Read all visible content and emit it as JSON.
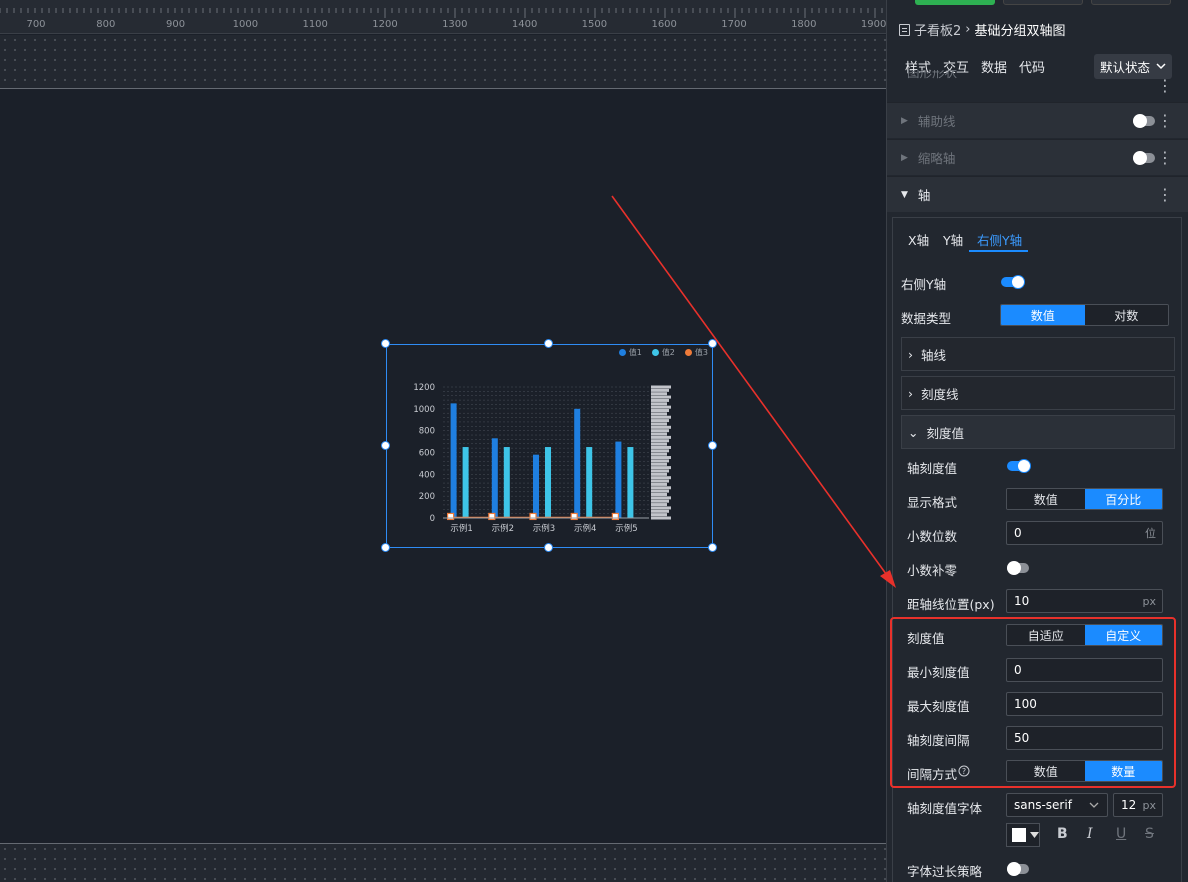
{
  "ruler": {
    "ticks": [
      "700",
      "800",
      "900",
      "1000",
      "1100",
      "1200",
      "1300",
      "1400",
      "1500",
      "1600",
      "1700",
      "1800",
      "1900"
    ]
  },
  "chart": {
    "legend": [
      {
        "label": "值1",
        "color": "#1f7fe0"
      },
      {
        "label": "值2",
        "color": "#3ec5e8"
      },
      {
        "label": "值3",
        "color": "#ef7b3a"
      }
    ]
  },
  "chart_data": {
    "type": "bar",
    "categories": [
      "示例1",
      "示例2",
      "示例3",
      "示例4",
      "示例5"
    ],
    "series": [
      {
        "name": "值1",
        "values": [
          1050,
          730,
          580,
          1000,
          700
        ],
        "color": "#1f7fe0"
      },
      {
        "name": "值2",
        "values": [
          650,
          650,
          650,
          650,
          650
        ],
        "color": "#3ec5e8"
      },
      {
        "name": "值3",
        "values": [
          5,
          5,
          5,
          5,
          5
        ],
        "color": "#ef7b3a",
        "type": "line"
      }
    ],
    "yticks": [
      "0",
      "200",
      "400",
      "600",
      "800",
      "1000",
      "1200"
    ],
    "ylim": [
      0,
      1200
    ],
    "right_axis_ticks": "dense overlapping percentage labels",
    "grid": true,
    "legend_position": "top-right"
  },
  "panel": {
    "breadcrumb": {
      "parent": "子看板2",
      "sep": "›",
      "current": "基础分组双轴图"
    },
    "tabs": [
      "样式",
      "交互",
      "数据",
      "代码"
    ],
    "state_select": "默认状态",
    "sections": [
      {
        "label": "图形形状"
      },
      {
        "label": "辅助线"
      },
      {
        "label": "缩略轴"
      },
      {
        "label": "轴"
      }
    ],
    "axis_tabs": [
      "X轴",
      "Y轴",
      "右侧Y轴"
    ],
    "right_y": {
      "enabled_label": "右侧Y轴",
      "data_type_label": "数据类型",
      "data_type_options": [
        "数值",
        "对数"
      ],
      "folds": [
        "轴线",
        "刻度线",
        "刻度值"
      ],
      "tick_value_label": "轴刻度值",
      "display_format_label": "显示格式",
      "display_format_options": [
        "数值",
        "百分比"
      ],
      "decimals_label": "小数位数",
      "decimals_value": "0",
      "decimals_unit": "位",
      "pad_zero_label": "小数补零",
      "distance_label": "距轴线位置(px)",
      "distance_value": "10",
      "distance_unit": "px",
      "scale_label": "刻度值",
      "scale_options": [
        "自适应",
        "自定义"
      ],
      "min_label": "最小刻度值",
      "min_value": "0",
      "max_label": "最大刻度值",
      "max_value": "100",
      "interval_label": "轴刻度间隔",
      "interval_value": "50",
      "interval_mode_label": "间隔方式",
      "interval_mode_options": [
        "数值",
        "数量"
      ],
      "font_label": "轴刻度值字体",
      "font_family": "sans-serif",
      "font_size": "12",
      "font_unit": "px",
      "overflow_label": "字体过长策略"
    }
  },
  "colors": {
    "accent": "#1b8bff",
    "highlight": "#e8312b",
    "arrow": "#e8312b"
  }
}
